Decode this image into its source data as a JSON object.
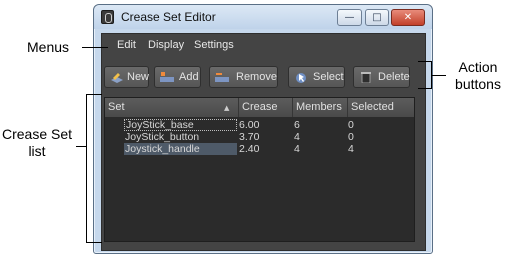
{
  "window": {
    "title": "Crease Set Editor",
    "controls": {
      "minimize": "—",
      "maximize": "□",
      "close": "✕"
    }
  },
  "menubar": {
    "items": [
      "Edit",
      "Display",
      "Settings"
    ]
  },
  "toolbar": {
    "buttons": [
      {
        "label": "New",
        "icon": "new-set-icon"
      },
      {
        "label": "Add",
        "icon": "add-members-icon"
      },
      {
        "label": "Remove",
        "icon": "remove-members-icon"
      },
      {
        "label": "Select",
        "icon": "select-icon"
      },
      {
        "label": "Delete",
        "icon": "delete-icon"
      }
    ]
  },
  "list": {
    "columns": [
      "Set",
      "Crease",
      "Members",
      "Selected"
    ],
    "sort_indicator": "▲",
    "rows": [
      {
        "set": "JoyStick_base",
        "crease": "6.00",
        "members": "6",
        "selected": "0"
      },
      {
        "set": "JoyStick_button",
        "crease": "3.70",
        "members": "4",
        "selected": "0"
      },
      {
        "set": "Joystick_handle",
        "crease": "2.40",
        "members": "4",
        "selected": "4"
      }
    ]
  },
  "annotations": {
    "menus": "Menus",
    "action_buttons": [
      "Action",
      "buttons"
    ],
    "crease_set_list": [
      "Crease Set",
      "list"
    ]
  },
  "colors": {
    "panel_bg": "#444444",
    "list_bg": "#2b2b2b",
    "selection_bg": "#4e5a68",
    "window_frame": "#c6d8ec"
  }
}
